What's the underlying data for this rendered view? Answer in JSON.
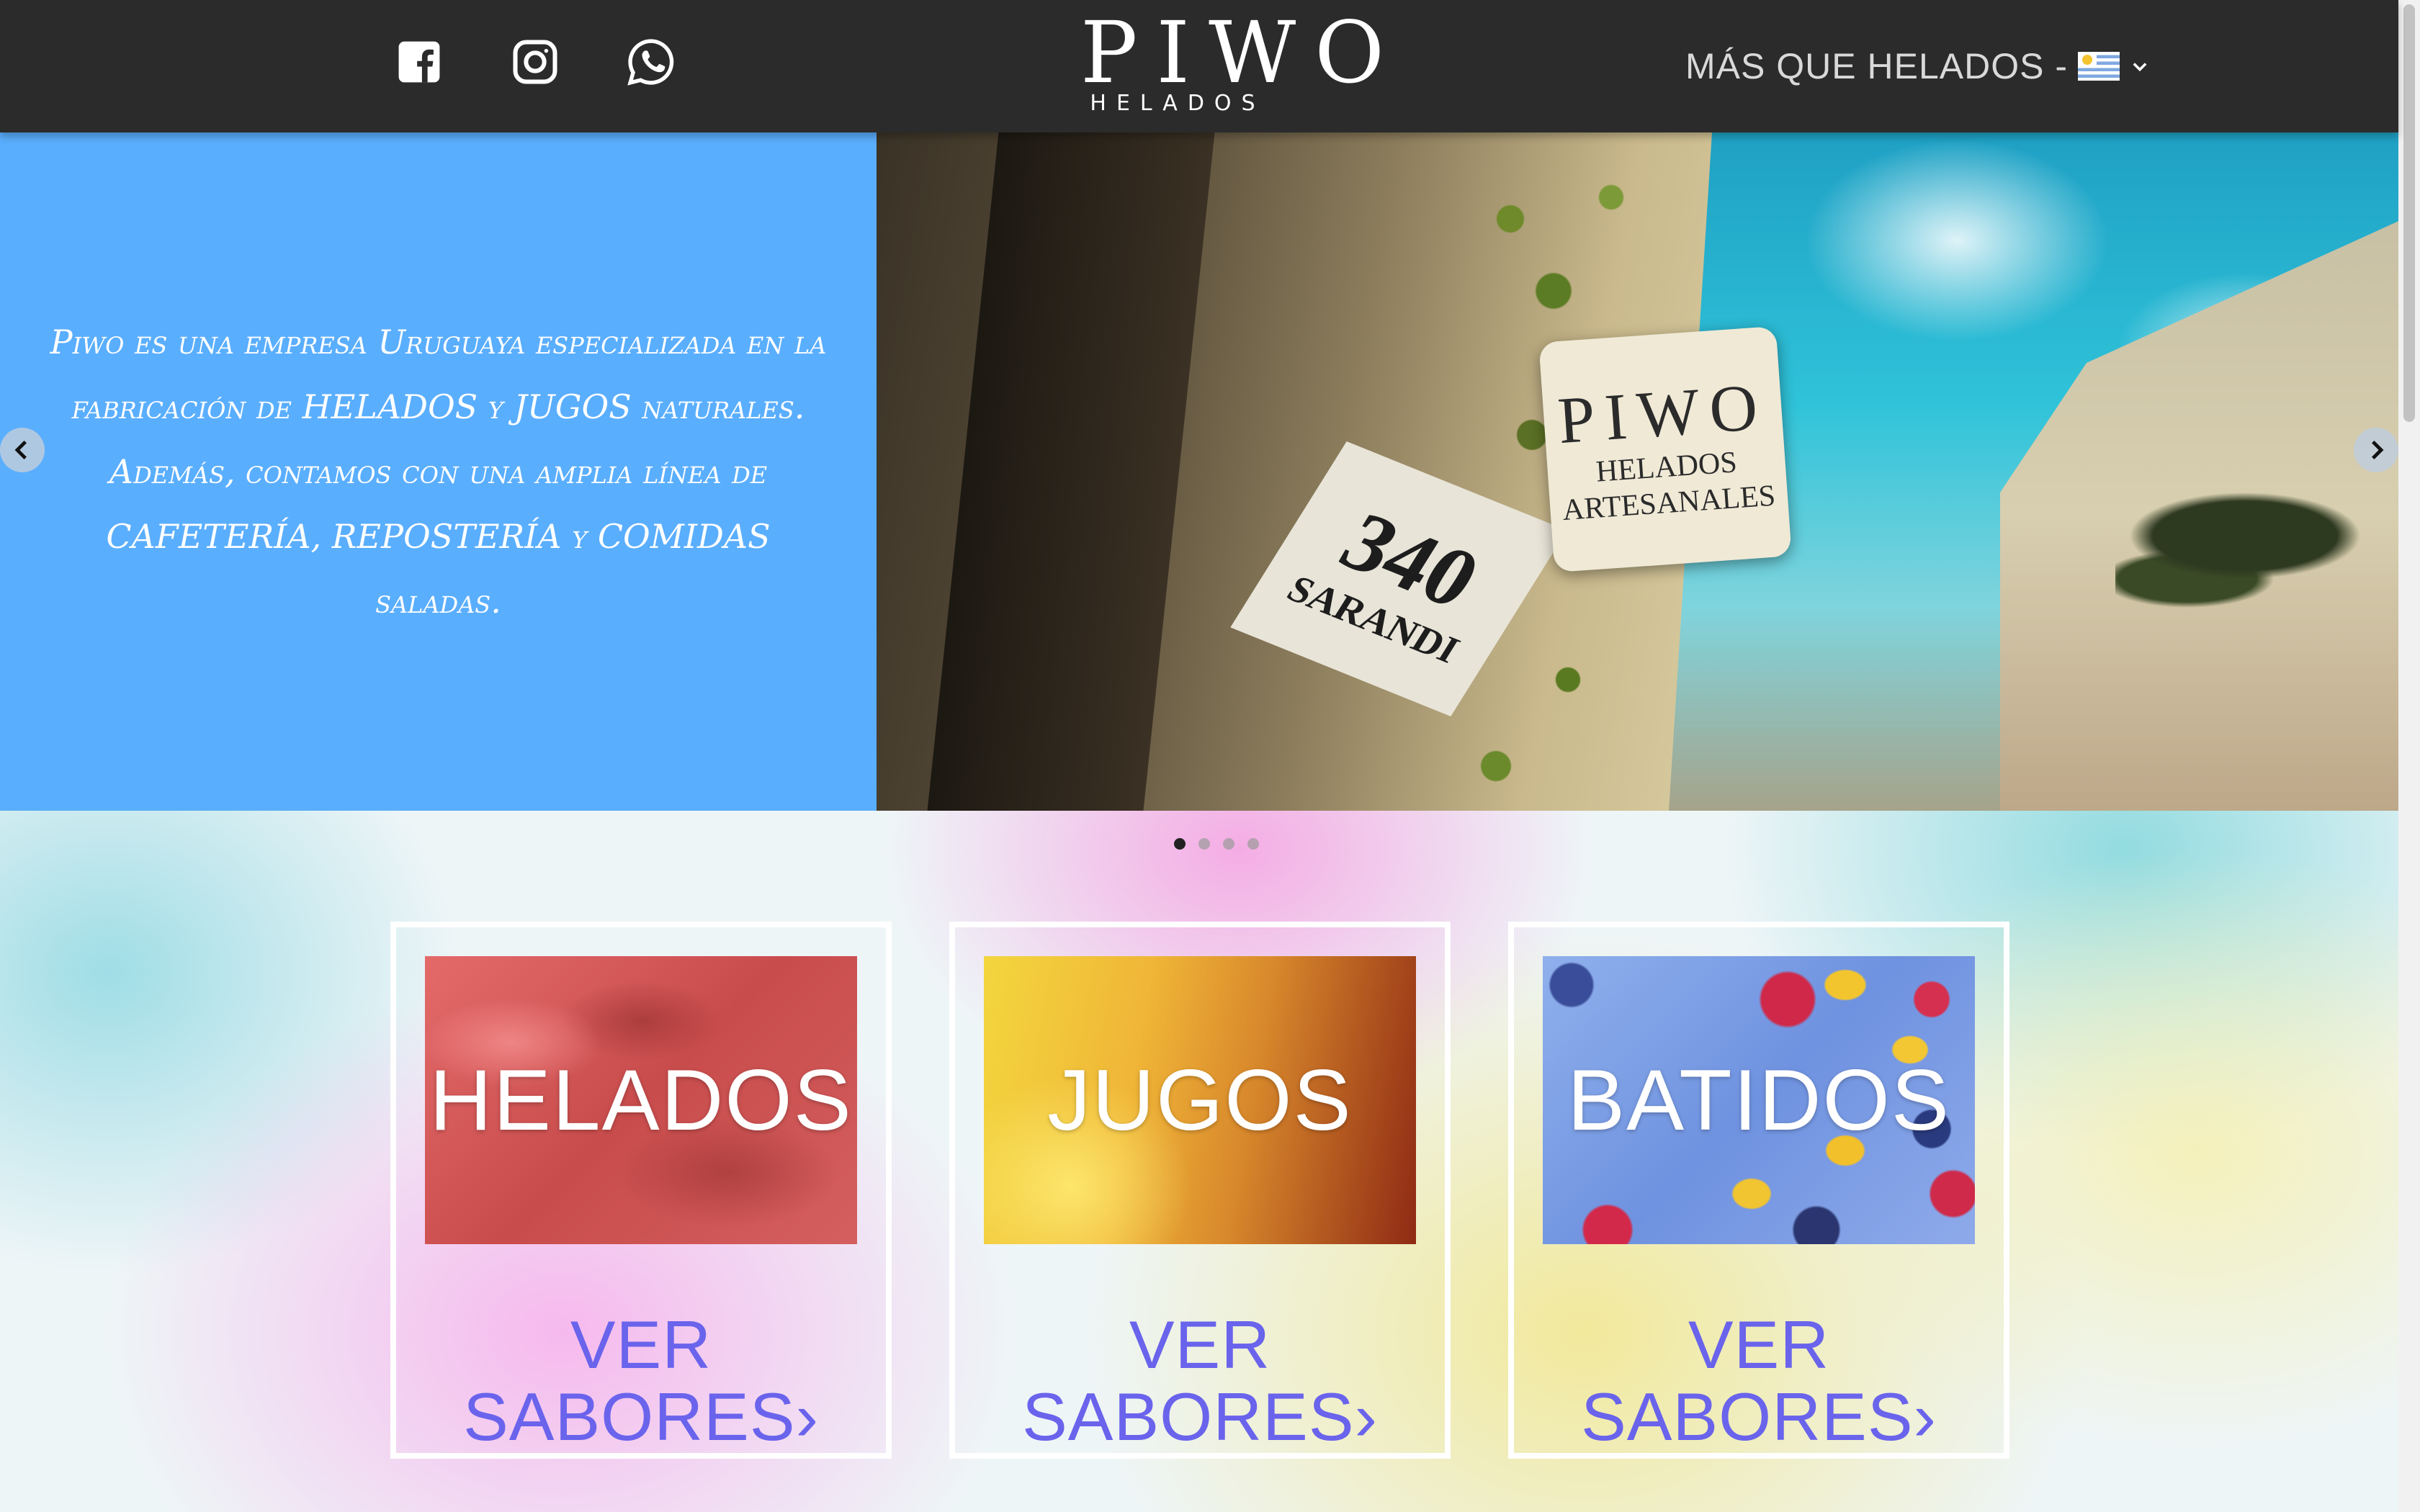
{
  "header": {
    "social": [
      {
        "name": "facebook"
      },
      {
        "name": "instagram"
      },
      {
        "name": "whatsapp"
      }
    ],
    "logo": {
      "word": "PIWO",
      "sub": "HELADOS"
    },
    "language": {
      "label": "MÁS QUE HELADOS -",
      "flag": "uruguay-flag"
    }
  },
  "slider": {
    "text": "Piwo es una empresa Uruguaya especializada en la fabricación de HELADOS y JUGOS naturales. Además, contamos con una amplia línea de CAFETERÍA, REPOSTERÍA y COMIDAS saladas.",
    "photo_sign": {
      "line1": "PIWO",
      "line2": "HELADOS",
      "line3": "ARTESANALES"
    },
    "photo_number": {
      "line1": "340",
      "line2": "SARANDI"
    },
    "dots": 4,
    "active_dot": 0
  },
  "cards": [
    {
      "title": "HELADOS",
      "link": "VER SABORES›"
    },
    {
      "title": "JUGOS",
      "link": "VER SABORES›"
    },
    {
      "title": "BATIDOS",
      "link": "VER SABORES›"
    }
  ],
  "colors": {
    "topbar": "#2b2b2b",
    "slide_bg": "#5aaefe",
    "link": "#6a63ec"
  }
}
